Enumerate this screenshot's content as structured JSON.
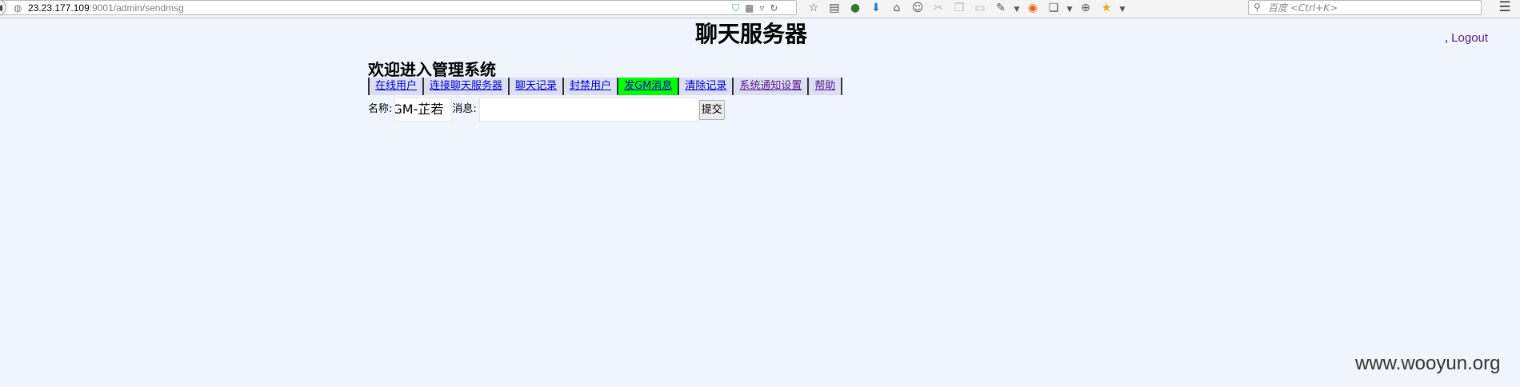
{
  "browser": {
    "url_host": "23.23.177.109",
    "url_rest": ":9001/admin/sendmsg",
    "search_placeholder": "百度 <Ctrl+K>"
  },
  "header": {
    "title": "聊天服务器",
    "separator": ",",
    "logout_label": "Logout"
  },
  "welcome": "欢迎进入管理系统",
  "nav": {
    "tabs": [
      {
        "label": "在线用户"
      },
      {
        "label": "连接聊天服务器"
      },
      {
        "label": "聊天记录"
      },
      {
        "label": "封禁用户"
      },
      {
        "label": "发GM消息",
        "active": true
      },
      {
        "label": "清除记录"
      },
      {
        "label": "系统通知设置"
      },
      {
        "label": "帮助"
      }
    ]
  },
  "form": {
    "name_label": "名称:",
    "name_value": "GM-芷若",
    "message_label": "消息:",
    "message_value": "",
    "submit_label": "提交"
  },
  "watermark": "www.wooyun.org",
  "colors": {
    "page_background": "#f0f5fd",
    "active_tab": "#00ff00",
    "tab_background": "#dcdff3",
    "link": "#0000cc",
    "visited_link": "#551a8b"
  }
}
